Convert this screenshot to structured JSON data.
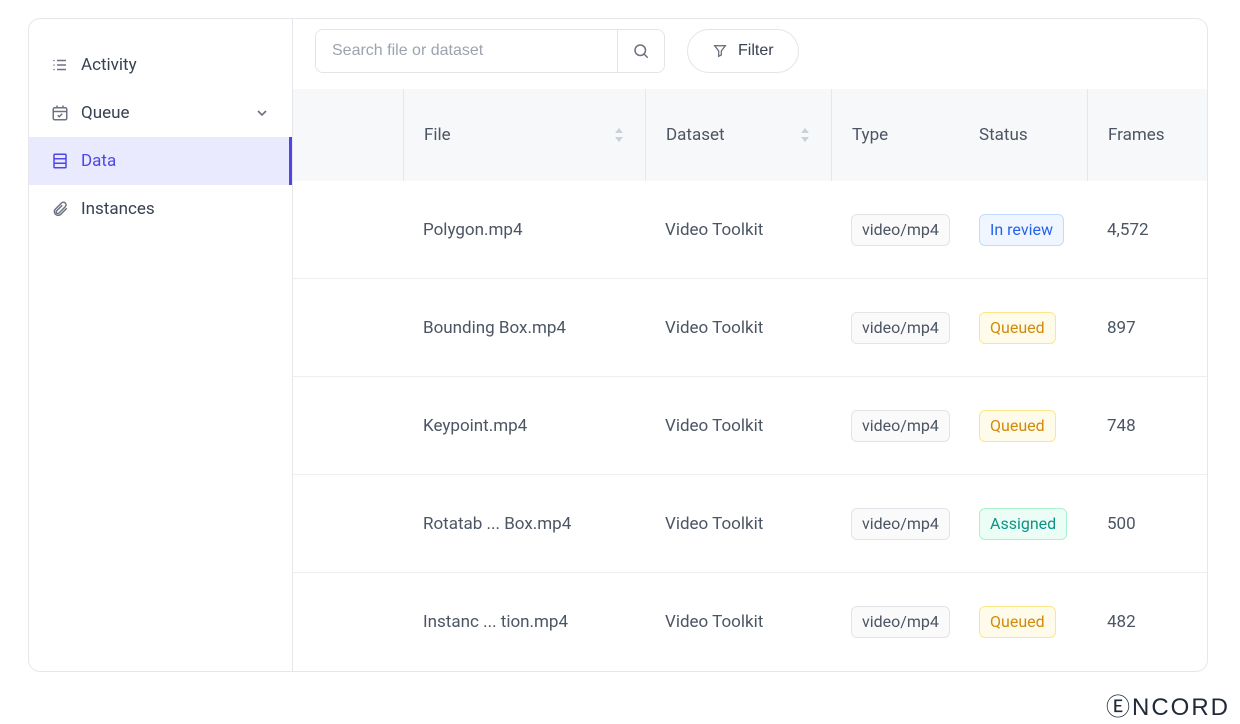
{
  "brand": "ⒺNCORD",
  "sidebar": {
    "items": [
      {
        "label": "Activity"
      },
      {
        "label": "Queue"
      },
      {
        "label": "Data"
      },
      {
        "label": "Instances"
      }
    ]
  },
  "toolbar": {
    "search_placeholder": "Search file or dataset",
    "filter_label": "Filter"
  },
  "table": {
    "columns": {
      "file": "File",
      "dataset": "Dataset",
      "type": "Type",
      "status": "Status",
      "frames": "Frames"
    },
    "rows": [
      {
        "file": "Polygon.mp4",
        "dataset": "Video Toolkit",
        "type": "video/mp4",
        "status": "In review",
        "status_class": "inreview",
        "frames": "4,572"
      },
      {
        "file": "Bounding Box.mp4",
        "dataset": "Video Toolkit",
        "type": "video/mp4",
        "status": "Queued",
        "status_class": "queued",
        "frames": "897"
      },
      {
        "file": "Keypoint.mp4",
        "dataset": "Video Toolkit",
        "type": "video/mp4",
        "status": "Queued",
        "status_class": "queued",
        "frames": "748"
      },
      {
        "file": "Rotatab ... Box.mp4",
        "dataset": "Video Toolkit",
        "type": "video/mp4",
        "status": "Assigned",
        "status_class": "assigned",
        "frames": "500"
      },
      {
        "file": "Instanc ... tion.mp4",
        "dataset": "Video Toolkit",
        "type": "video/mp4",
        "status": "Queued",
        "status_class": "queued",
        "frames": "482"
      }
    ]
  }
}
